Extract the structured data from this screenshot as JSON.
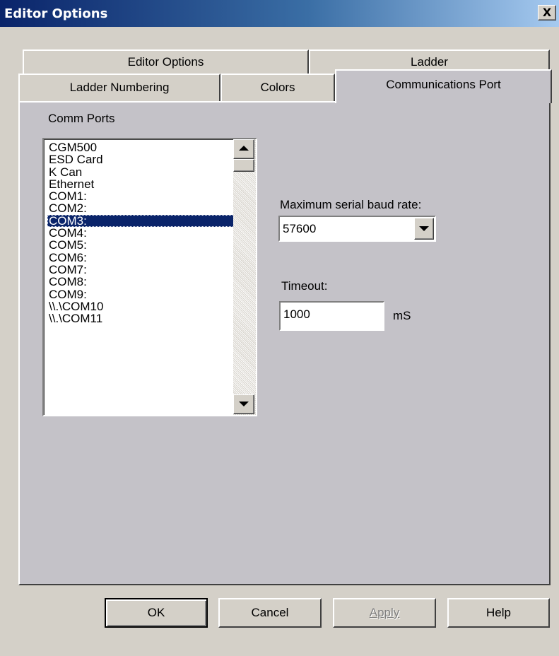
{
  "window": {
    "title": "Editor Options",
    "close_label": "X"
  },
  "tabs": {
    "row1": [
      "Editor Options",
      "Ladder"
    ],
    "row2": [
      "Ladder Numbering",
      "Colors",
      "Communications Port"
    ],
    "active": "Communications Port"
  },
  "comm_ports": {
    "label": "Comm Ports",
    "items": [
      "CGM500",
      "ESD Card",
      "K Can",
      "Ethernet",
      "COM1:",
      "COM2:",
      "COM3:",
      "COM4:",
      "COM5:",
      "COM6:",
      "COM7:",
      "COM8:",
      "COM9:",
      "\\\\.\\COM10",
      "\\\\.\\COM11"
    ],
    "selected": "COM3:"
  },
  "baud": {
    "label": "Maximum serial baud rate:",
    "value": "57600"
  },
  "timeout": {
    "label": "Timeout:",
    "value": "1000",
    "unit": "mS"
  },
  "buttons": {
    "ok": "OK",
    "cancel": "Cancel",
    "apply": "Apply",
    "help": "Help"
  },
  "colors": {
    "titlebar_start": "#0a246a",
    "selection": "#0a246a",
    "face": "#d4d0c8"
  }
}
